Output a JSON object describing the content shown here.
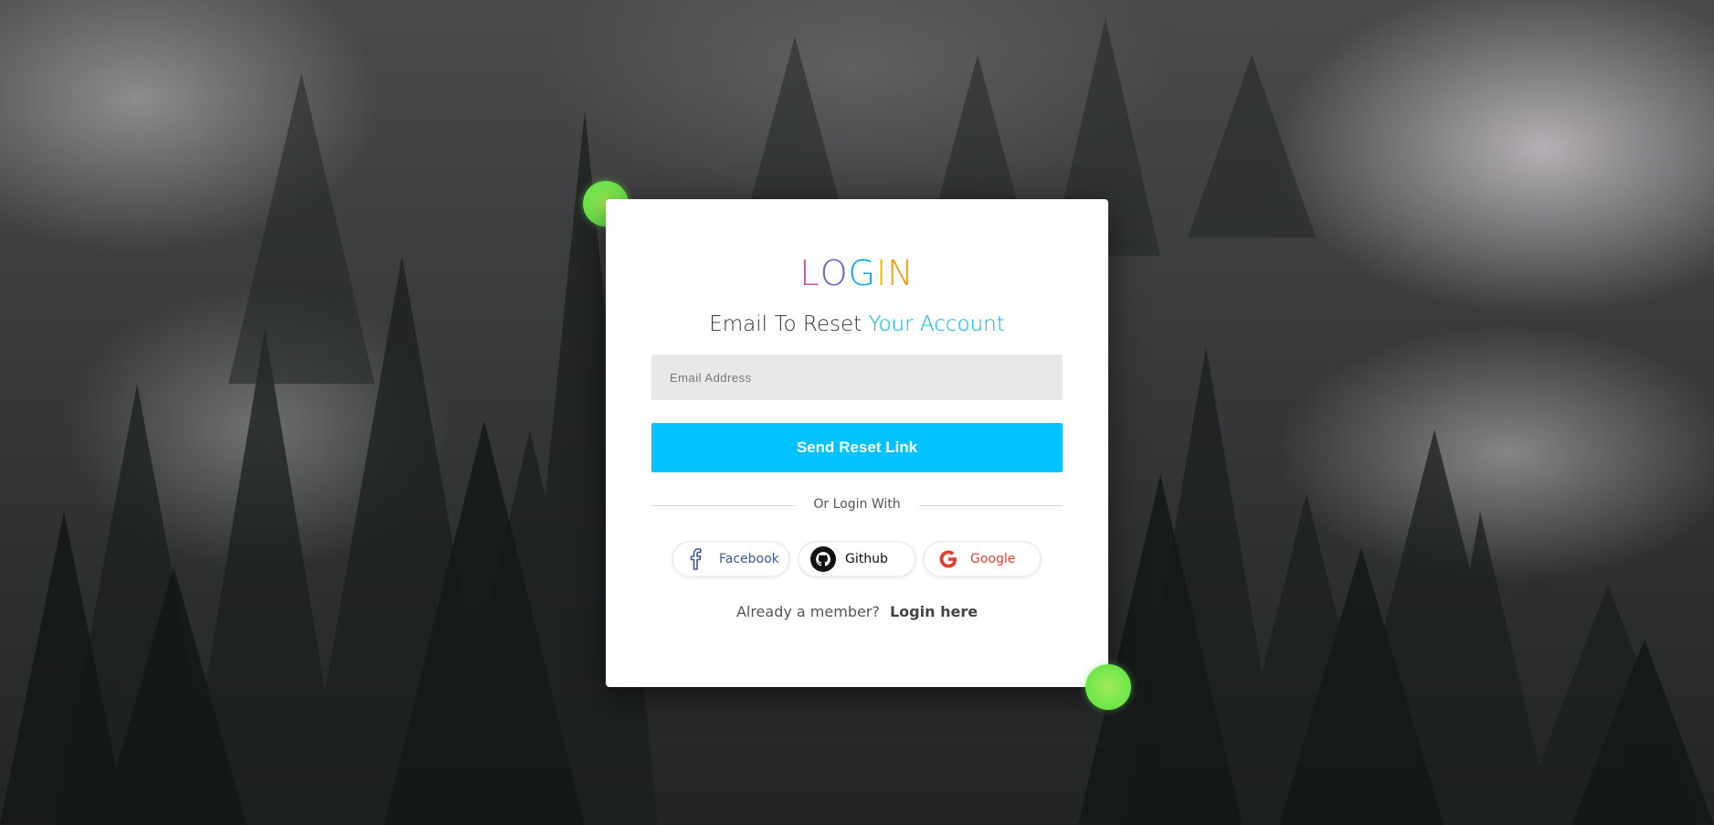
{
  "brand": {
    "logo_letters": [
      "L",
      "O",
      "G",
      "I",
      "N"
    ],
    "logo_colors": [
      "#d4509a",
      "#6a5fc0",
      "#00a9e8",
      "#f4b400",
      "#f39c12"
    ]
  },
  "heading": {
    "prefix": "Email To Reset",
    "accent": "Your Account",
    "accent_color": "#00b4f0"
  },
  "form": {
    "email_placeholder": "Email Address",
    "email_value": "",
    "submit_label": "Send Reset Link",
    "submit_color": "#00c3ff"
  },
  "divider": {
    "label": "Or Login With"
  },
  "social": [
    {
      "id": "facebook",
      "label": "Facebook",
      "icon": "facebook-icon",
      "color": "#3b5998"
    },
    {
      "id": "github",
      "label": "Github",
      "icon": "github-icon",
      "color": "#111111"
    },
    {
      "id": "google",
      "label": "Google",
      "icon": "google-icon",
      "color": "#e0402f"
    }
  ],
  "footer": {
    "prompt": "Already a member?",
    "link": "Login here"
  },
  "decor": {
    "dot_color": "#7bea4f"
  }
}
